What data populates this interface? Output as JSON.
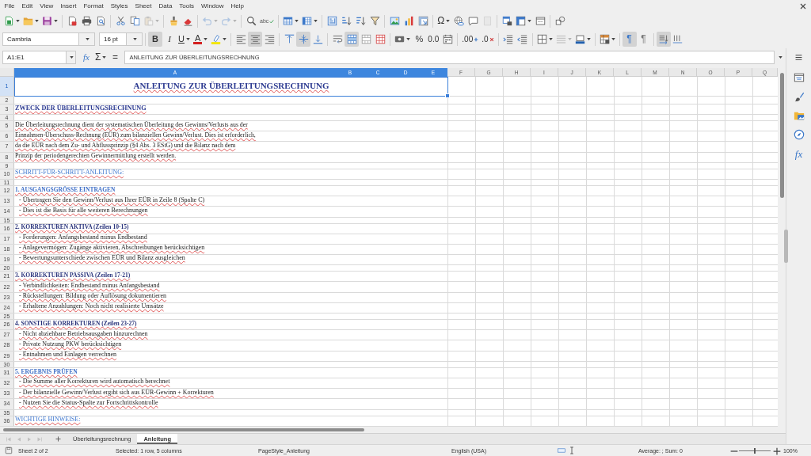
{
  "menu": [
    "File",
    "Edit",
    "View",
    "Insert",
    "Format",
    "Styles",
    "Sheet",
    "Data",
    "Tools",
    "Window",
    "Help"
  ],
  "standard_toolbar": [
    [
      {
        "kind": "new",
        "dropdown": true,
        "disabled": false
      },
      {
        "kind": "open",
        "dropdown": true,
        "disabled": false
      },
      {
        "kind": "save",
        "dropdown": true,
        "disabled": false
      }
    ],
    [
      {
        "kind": "pdf",
        "dropdown": false,
        "disabled": false
      },
      {
        "kind": "print",
        "dropdown": false,
        "disabled": false
      },
      {
        "kind": "preview",
        "dropdown": false,
        "disabled": false
      }
    ],
    [
      {
        "kind": "cut",
        "dropdown": false,
        "disabled": false
      },
      {
        "kind": "copy",
        "dropdown": false,
        "disabled": false
      },
      {
        "kind": "paste",
        "dropdown": true,
        "disabled": true
      }
    ],
    [
      {
        "kind": "clone",
        "dropdown": false,
        "disabled": false
      },
      {
        "kind": "clear",
        "dropdown": false,
        "disabled": false
      }
    ],
    [
      {
        "kind": "undo",
        "dropdown": true,
        "disabled": true
      },
      {
        "kind": "redo",
        "dropdown": true,
        "disabled": true
      }
    ],
    [
      {
        "kind": "find",
        "dropdown": false,
        "disabled": false
      },
      {
        "kind": "spelling",
        "label": "abc",
        "dropdown": false,
        "disabled": false
      }
    ],
    [
      {
        "kind": "rows",
        "dropdown": true,
        "disabled": false
      },
      {
        "kind": "columns",
        "dropdown": true,
        "disabled": false
      }
    ],
    [
      {
        "kind": "sort",
        "dropdown": false,
        "disabled": false
      },
      {
        "kind": "sortasc",
        "dropdown": false,
        "disabled": false
      },
      {
        "kind": "sortdesc",
        "dropdown": false,
        "disabled": false
      },
      {
        "kind": "filter",
        "dropdown": false,
        "disabled": false
      }
    ],
    [
      {
        "kind": "image",
        "dropdown": false,
        "disabled": false
      },
      {
        "kind": "chart",
        "dropdown": false,
        "disabled": false
      },
      {
        "kind": "pivot",
        "dropdown": false,
        "disabled": false
      }
    ],
    [
      {
        "kind": "special",
        "label": "Ω",
        "dropdown": true,
        "disabled": false
      },
      {
        "kind": "hyperlink",
        "dropdown": false,
        "disabled": false
      },
      {
        "kind": "comment",
        "dropdown": false,
        "disabled": false
      },
      {
        "kind": "headerfooter",
        "dropdown": false,
        "disabled": true
      }
    ],
    [
      {
        "kind": "printarea",
        "dropdown": false,
        "disabled": false
      },
      {
        "kind": "freeze",
        "dropdown": true,
        "disabled": false
      },
      {
        "kind": "split",
        "dropdown": false,
        "disabled": false
      }
    ],
    [
      {
        "kind": "shapes",
        "dropdown": false,
        "disabled": false
      }
    ]
  ],
  "formatting_toolbar": {
    "font_name": "Cambria",
    "font_size": "16 pt",
    "groups": [
      [
        {
          "kind": "bold",
          "label": "B",
          "dropdown": false,
          "active": true,
          "disabled": false
        },
        {
          "kind": "italic",
          "label": "I",
          "dropdown": false,
          "active": false,
          "disabled": false
        },
        {
          "kind": "underline",
          "label": "U",
          "dropdown": true,
          "active": false,
          "disabled": false
        },
        {
          "kind": "fontcolor",
          "label": "A",
          "dropdown": true,
          "active": false,
          "disabled": false
        },
        {
          "kind": "highlight",
          "dropdown": true,
          "active": false,
          "disabled": false
        }
      ],
      [
        {
          "kind": "alignleft",
          "dropdown": false,
          "active": false,
          "disabled": false
        },
        {
          "kind": "center",
          "dropdown": false,
          "active": true,
          "disabled": false
        },
        {
          "kind": "alignright",
          "dropdown": false,
          "active": false,
          "disabled": false
        }
      ],
      [
        {
          "kind": "top",
          "dropdown": false,
          "active": false,
          "disabled": false
        },
        {
          "kind": "vcenter",
          "dropdown": false,
          "active": true,
          "disabled": false
        },
        {
          "kind": "bottom",
          "dropdown": false,
          "active": false,
          "disabled": false
        }
      ],
      [
        {
          "kind": "wrap",
          "dropdown": false,
          "active": false,
          "disabled": false
        },
        {
          "kind": "mergecenter",
          "dropdown": false,
          "active": true,
          "disabled": false
        },
        {
          "kind": "merge",
          "dropdown": false,
          "active": false,
          "disabled": false
        },
        {
          "kind": "unmerge",
          "dropdown": false,
          "active": false,
          "disabled": false
        }
      ],
      [
        {
          "kind": "numberformat",
          "dropdown": true,
          "active": false,
          "disabled": false
        },
        {
          "kind": "percent",
          "label": "%",
          "dropdown": false,
          "active": false,
          "disabled": false
        },
        {
          "kind": "decimal",
          "label": "0.0",
          "dropdown": false,
          "active": false,
          "disabled": false
        },
        {
          "kind": "date",
          "dropdown": false,
          "active": false,
          "disabled": false
        }
      ],
      [
        {
          "kind": "adddecimal",
          "label": ".00",
          "dropdown": false,
          "active": false,
          "disabled": false
        },
        {
          "kind": "deldecimal",
          "label": ".0",
          "dropdown": false,
          "active": false,
          "disabled": false
        }
      ],
      [
        {
          "kind": "indent",
          "dropdown": false,
          "active": false,
          "disabled": false
        },
        {
          "kind": "outdent",
          "dropdown": false,
          "active": false,
          "disabled": false
        }
      ],
      [
        {
          "kind": "borders",
          "dropdown": true,
          "active": false,
          "disabled": false
        },
        {
          "kind": "borderstyle",
          "dropdown": true,
          "active": false,
          "disabled": true
        },
        {
          "kind": "bordercolor",
          "dropdown": true,
          "active": false,
          "disabled": false
        }
      ],
      [
        {
          "kind": "conditional",
          "dropdown": true,
          "active": false,
          "disabled": false
        }
      ],
      [
        {
          "kind": "ltr",
          "label": "¶",
          "dropdown": false,
          "active": true,
          "disabled": false
        },
        {
          "kind": "rtl",
          "label": "¶",
          "dropdown": false,
          "active": false,
          "disabled": false
        }
      ],
      [
        {
          "kind": "textdir",
          "dropdown": false,
          "active": true,
          "disabled": false
        },
        {
          "kind": "vertical",
          "dropdown": false,
          "active": false,
          "disabled": false
        }
      ]
    ]
  },
  "formula_bar": {
    "name_box": "A1:E1",
    "function_wizard": "fx",
    "sum": "Σ",
    "equals": "=",
    "formula": "ANLEITUNG ZUR ÜBERLEITUNGSRECHNUNG"
  },
  "columns": [
    {
      "label": "A",
      "selected": true
    },
    {
      "label": "B",
      "selected": true
    },
    {
      "label": "C",
      "selected": true
    },
    {
      "label": "D",
      "selected": true
    },
    {
      "label": "E",
      "selected": true
    },
    {
      "label": "F",
      "selected": false
    },
    {
      "label": "G",
      "selected": false
    },
    {
      "label": "H",
      "selected": false
    },
    {
      "label": "I",
      "selected": false
    },
    {
      "label": "J",
      "selected": false
    },
    {
      "label": "K",
      "selected": false
    },
    {
      "label": "L",
      "selected": false
    },
    {
      "label": "M",
      "selected": false
    },
    {
      "label": "N",
      "selected": false
    },
    {
      "label": "O",
      "selected": false
    },
    {
      "label": "P",
      "selected": false
    },
    {
      "label": "Q",
      "selected": false
    }
  ],
  "rows": [
    {
      "number": "1",
      "kind": "title",
      "selected": true,
      "text": "ANLEITUNG ZUR ÜBERLEITUNGSRECHNUNG"
    },
    {
      "number": "2",
      "kind": "blank",
      "selected": false
    },
    {
      "number": "3",
      "kind": "heading",
      "selected": false,
      "text": "ZWECK DER ÜBERLEITUNGSRECHNUNG"
    },
    {
      "number": "4",
      "kind": "spacer",
      "selected": false
    },
    {
      "number": "5",
      "kind": "text",
      "selected": false,
      "text": "Die Überleitungsrechnung dient der systematischen Überleitung des Gewinns/Verlusts aus der"
    },
    {
      "number": "6",
      "kind": "text",
      "selected": false,
      "text": "Einnahmen-Überschuss-Rechnung (EÜR) zum bilanziellen Gewinn/Verlust. Dies ist erforderlich,"
    },
    {
      "number": "7",
      "kind": "text",
      "selected": false,
      "text": "da die EÜR nach dem Zu- und Abflussprinzip (§4 Abs. 3 EStG) und die Bilanz nach dem"
    },
    {
      "number": "8",
      "kind": "text",
      "selected": false,
      "text": "Prinzip der periodengerechten Gewinnermittlung erstellt werden."
    },
    {
      "number": "9",
      "kind": "spacer",
      "selected": false
    },
    {
      "number": "10",
      "kind": "subheading",
      "selected": false,
      "text": "SCHRITT-FÜR-SCHRITT-ANLEITUNG:"
    },
    {
      "number": "11",
      "kind": "spacer",
      "selected": false
    },
    {
      "number": "12",
      "kind": "stepalt",
      "selected": false,
      "text": "1. AUSGANGSGRÖSSE EINTRAGEN"
    },
    {
      "number": "13",
      "kind": "bullet",
      "selected": false,
      "text": "- Übertragen Sie den Gewinn/Verlust aus Ihrer EÜR in Zeile 8 (Spalte C)"
    },
    {
      "number": "14",
      "kind": "bullet",
      "selected": false,
      "text": "- Dies ist die Basis für alle weiteren Berechnungen"
    },
    {
      "number": "15",
      "kind": "spacer",
      "selected": false
    },
    {
      "number": "16",
      "kind": "step",
      "selected": false,
      "text": "2. KORREKTUREN AKTIVA (Zeilen 10-15)"
    },
    {
      "number": "17",
      "kind": "bullet",
      "selected": false,
      "text": "- Forderungen: Anfangsbestand minus Endbestand"
    },
    {
      "number": "18",
      "kind": "bullet",
      "selected": false,
      "text": "- Anlagevermögen: Zugänge aktivieren, Abschreibungen berücksichtigen"
    },
    {
      "number": "19",
      "kind": "bullet",
      "selected": false,
      "text": "- Bewertungsunterschiede zwischen EÜR und Bilanz ausgleichen"
    },
    {
      "number": "20",
      "kind": "spacer",
      "selected": false
    },
    {
      "number": "21",
      "kind": "step",
      "selected": false,
      "text": "3. KORREKTUREN PASSIVA (Zeilen 17-21)"
    },
    {
      "number": "22",
      "kind": "bullet",
      "selected": false,
      "text": "- Verbindlichkeiten: Endbestand minus Anfangsbestand"
    },
    {
      "number": "23",
      "kind": "bullet",
      "selected": false,
      "text": "- Rückstellungen: Bildung oder Auflösung dokumentieren"
    },
    {
      "number": "24",
      "kind": "bullet",
      "selected": false,
      "text": "- Erhaltene Anzahlungen: Noch nicht realisierte Umsätze"
    },
    {
      "number": "25",
      "kind": "spacer",
      "selected": false
    },
    {
      "number": "26",
      "kind": "step",
      "selected": false,
      "text": "4. SONSTIGE KORREKTUREN (Zeilen 23-27)"
    },
    {
      "number": "27",
      "kind": "bullet",
      "selected": false,
      "text": "- Nicht abziehbare Betriebsausgaben hinzurechnen"
    },
    {
      "number": "28",
      "kind": "bullet",
      "selected": false,
      "text": "- Private Nutzung PKW berücksichtigen"
    },
    {
      "number": "29",
      "kind": "bullet",
      "selected": false,
      "text": "- Entnahmen und Einlagen verrechnen"
    },
    {
      "number": "30",
      "kind": "spacer",
      "selected": false
    },
    {
      "number": "31",
      "kind": "stepalt",
      "selected": false,
      "text": "5. ERGEBNIS PRÜFEN"
    },
    {
      "number": "32",
      "kind": "bullet",
      "selected": false,
      "text": "- Die Summe aller Korrekturen wird automatisch berechnet"
    },
    {
      "number": "33",
      "kind": "bullet",
      "selected": false,
      "text": "- Der bilanzielle Gewinn/Verlust ergibt sich aus EÜR-Gewinn + Korrekturen"
    },
    {
      "number": "34",
      "kind": "bullet",
      "selected": false,
      "text": "- Nutzen Sie die Status-Spalte zur Fortschrittskontrolle"
    },
    {
      "number": "35",
      "kind": "spacer",
      "selected": false
    },
    {
      "number": "36",
      "kind": "subheading",
      "selected": false,
      "text": "WICHTIGE HINWEISE:"
    }
  ],
  "sidebar": [
    {
      "kind": "properties"
    },
    {
      "kind": "styles"
    },
    {
      "kind": "gallery"
    },
    {
      "kind": "navigator"
    },
    {
      "kind": "functions",
      "label": "fx"
    }
  ],
  "sheet_nav": [
    {
      "kind": "first",
      "disabled": true
    },
    {
      "kind": "previous",
      "disabled": true
    },
    {
      "kind": "next",
      "disabled": true
    },
    {
      "kind": "last",
      "disabled": true
    }
  ],
  "sheet_tabs": [
    {
      "label": "Überleitungsrechnung",
      "selected": false
    },
    {
      "label": "Anleitung",
      "selected": true
    }
  ],
  "status_bar": {
    "sheet": "Sheet 2 of 2",
    "selection": "Selected: 1 row, 5 columns",
    "page_style": "PageStyle_Anleitung",
    "language": "English (USA)",
    "summary": "Average: ; Sum: 0",
    "zoom": {
      "level": 0.5,
      "label": "100%"
    }
  }
}
